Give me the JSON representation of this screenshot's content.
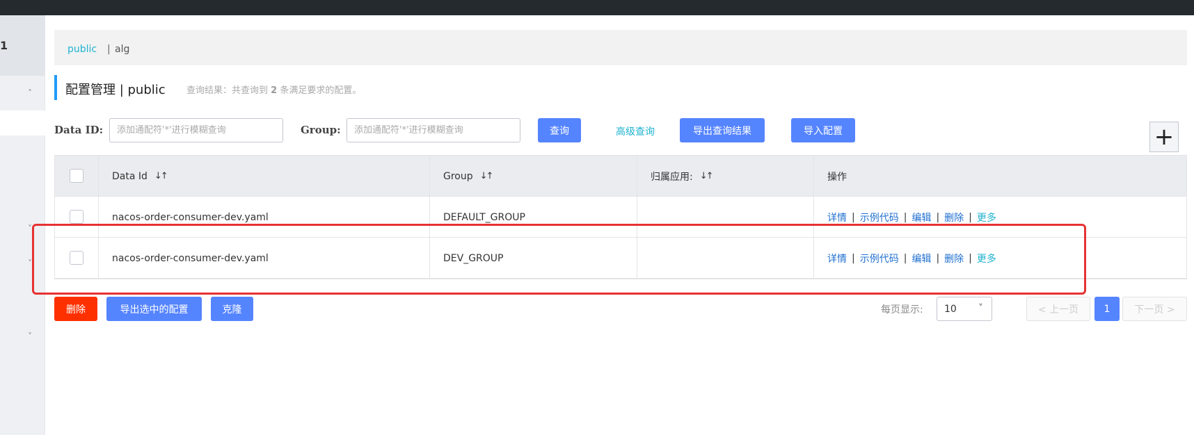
{
  "sidebar": {
    "top_label": "1"
  },
  "namespace": {
    "active": "public",
    "separator": "|",
    "other": "alg"
  },
  "header": {
    "title": "配置管理 | public",
    "result_prefix": "查询结果：共查询到",
    "result_count": "2",
    "result_suffix": "条满足要求的配置。"
  },
  "search": {
    "data_id_label": "Data ID:",
    "data_id_placeholder": "添加通配符'*'进行模糊查询",
    "group_label": "Group:",
    "group_placeholder": "添加通配符'*'进行模糊查询",
    "query_label": "查询",
    "advanced_label": "高级查询",
    "export_label": "导出查询结果",
    "import_label": "导入配置"
  },
  "table": {
    "headers": {
      "data_id": "Data Id",
      "group": "Group",
      "app": "归属应用:",
      "ops": "操作"
    },
    "sort_icon": "↓↑",
    "rows": [
      {
        "data_id": "nacos-order-consumer-dev.yaml",
        "group": "DEFAULT_GROUP",
        "app": ""
      },
      {
        "data_id": "nacos-order-consumer-dev.yaml",
        "group": "DEV_GROUP",
        "app": ""
      }
    ],
    "ops": {
      "detail": "详情",
      "sample": "示例代码",
      "edit": "编辑",
      "delete": "删除",
      "more": "更多",
      "sep": "|"
    }
  },
  "footer": {
    "delete_label": "删除",
    "export_selected_label": "导出选中的配置",
    "clone_label": "克隆",
    "per_page_label": "每页显示:",
    "per_page_value": "10",
    "prev_label": "< 上一页",
    "current_page": "1",
    "next_label": "下一页 >"
  },
  "colors": {
    "primary": "#5584ff",
    "danger": "#ff3000",
    "link": "#2070d0",
    "accent": "#1fb3d0",
    "highlight_box": "#e63232"
  },
  "icons": [
    "plus-icon",
    "chevron-up-icon",
    "chevron-down-icon",
    "sort-icon"
  ]
}
